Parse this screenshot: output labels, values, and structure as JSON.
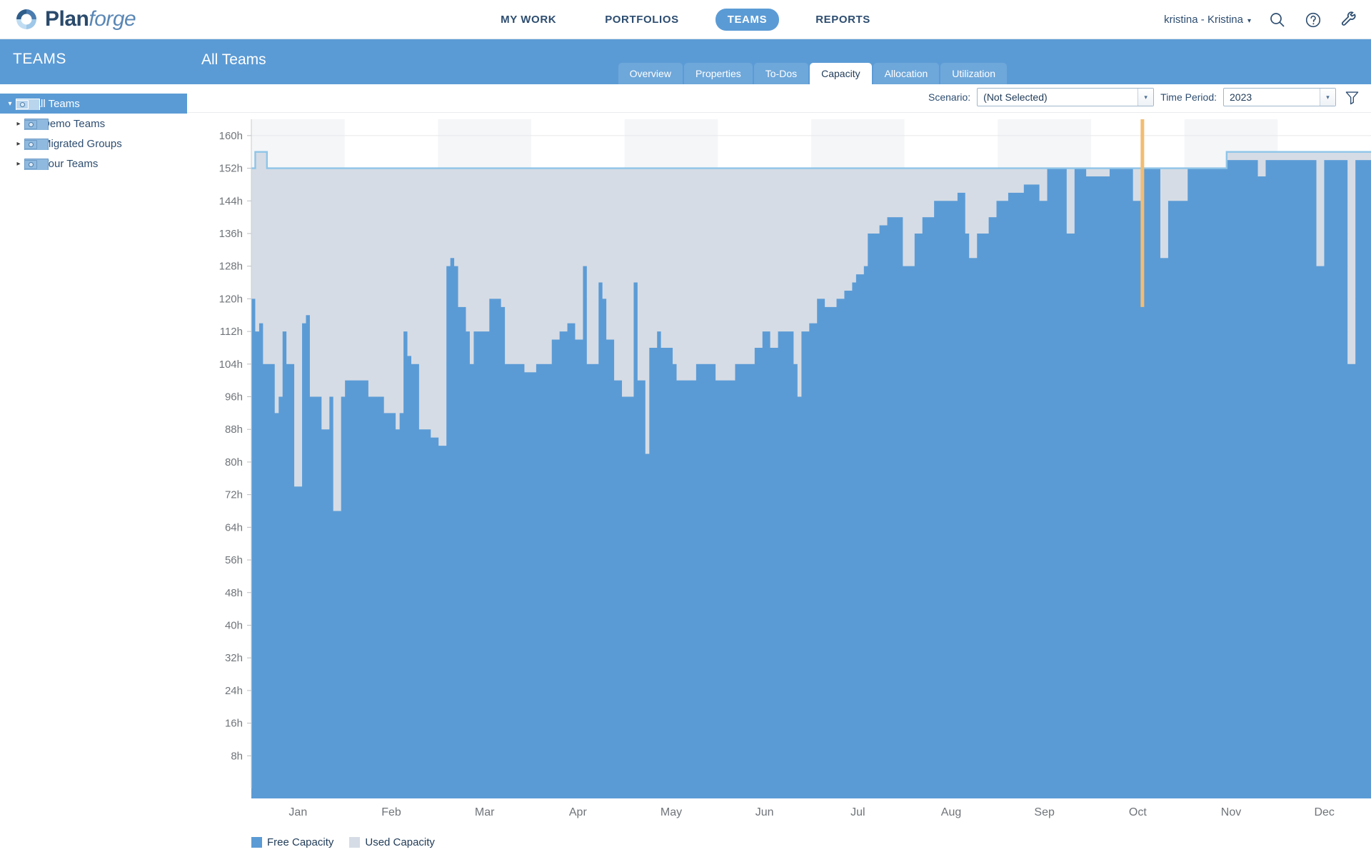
{
  "app": {
    "brand_main": "Plan",
    "brand_italic": "forge",
    "logo_icon": "planforge-swirl-logo"
  },
  "header": {
    "nav": [
      {
        "label": "MY WORK",
        "active": false
      },
      {
        "label": "PORTFOLIOS",
        "active": false
      },
      {
        "label": "TEAMS",
        "active": true
      },
      {
        "label": "REPORTS",
        "active": false
      }
    ],
    "user": "kristina - Kristina",
    "user_caret": "▾",
    "icons": [
      "search-icon",
      "help-icon",
      "tools-wrench-icon"
    ]
  },
  "sidebar": {
    "title": "TEAMS",
    "items": [
      {
        "label": "All Teams",
        "depth": 0,
        "selected": true,
        "twisty": "▾"
      },
      {
        "label": "Demo Teams",
        "depth": 1,
        "selected": false,
        "twisty": "▸"
      },
      {
        "label": "Migrated Groups",
        "depth": 1,
        "selected": false,
        "twisty": "▸"
      },
      {
        "label": "Your Teams",
        "depth": 1,
        "selected": false,
        "twisty": "▸"
      }
    ]
  },
  "page": {
    "title": "All Teams",
    "tabs": [
      {
        "label": "Overview",
        "active": false
      },
      {
        "label": "Properties",
        "active": false
      },
      {
        "label": "To-Dos",
        "active": false
      },
      {
        "label": "Capacity",
        "active": true
      },
      {
        "label": "Allocation",
        "active": false
      },
      {
        "label": "Utilization",
        "active": false
      }
    ]
  },
  "toolbar": {
    "scenario_label": "Scenario:",
    "scenario_value": "(Not Selected)",
    "period_label": "Time Period:",
    "period_value": "2023",
    "dropdown_arrow": "▾",
    "filter_icon": "funnel-filter-icon"
  },
  "colors": {
    "free_capacity": "#5b9bd5",
    "used_capacity": "#d6dce5",
    "capacity_outline": "#8ec4e8",
    "today_marker": "#f2bd72",
    "header_blue": "#5b9bd5",
    "text_dark": "#1f3a57",
    "band_shade": "#f4f6f8",
    "gridline": "#e6e8ea"
  },
  "chart_data": {
    "type": "area",
    "title": "",
    "xlabel": "",
    "ylabel": "",
    "ylim": [
      0,
      164
    ],
    "ytick_step": 8,
    "ytick_unit": "h",
    "yticks": [
      8,
      16,
      24,
      32,
      40,
      48,
      56,
      64,
      72,
      80,
      88,
      96,
      104,
      112,
      120,
      128,
      136,
      144,
      152,
      160
    ],
    "ytick_labels": [
      "8h",
      "16h",
      "24h",
      "32h",
      "40h",
      "48h",
      "56h",
      "64h",
      "72h",
      "80h",
      "88h",
      "96h",
      "104h",
      "112h",
      "120h",
      "128h",
      "136h",
      "144h",
      "152h",
      "160h"
    ],
    "categories": [
      "Jan",
      "Feb",
      "Mar",
      "Apr",
      "May",
      "Jun",
      "Jul",
      "Aug",
      "Sep",
      "Oct",
      "Nov",
      "Dec"
    ],
    "grid": true,
    "legend_position": "bottom-left",
    "today_marker_month_fraction": 9.55,
    "series": [
      {
        "name": "Free Capacity",
        "color": "#5b9bd5",
        "stack": "bottom",
        "values": [
          120,
          112,
          114,
          104,
          104,
          104,
          92,
          96,
          112,
          104,
          104,
          74,
          74,
          114,
          116,
          96,
          96,
          96,
          88,
          88,
          96,
          68,
          68,
          96,
          100,
          100,
          100,
          100,
          100,
          100,
          96,
          96,
          96,
          96,
          92,
          92,
          92,
          88,
          92,
          112,
          106,
          104,
          104,
          88,
          88,
          88,
          86,
          86,
          84,
          84,
          128,
          130,
          128,
          118,
          118,
          112,
          104,
          112,
          112,
          112,
          112,
          120,
          120,
          120,
          118,
          104,
          104,
          104,
          104,
          104,
          102,
          102,
          102,
          104,
          104,
          104,
          104,
          110,
          110,
          112,
          112,
          114,
          114,
          110,
          110,
          128,
          104,
          104,
          104,
          124,
          120,
          110,
          110,
          100,
          100,
          96,
          96,
          96,
          124,
          100,
          100,
          82,
          108,
          108,
          112,
          108,
          108,
          108,
          104,
          100,
          100,
          100,
          100,
          100,
          104,
          104,
          104,
          104,
          104,
          100,
          100,
          100,
          100,
          100,
          104,
          104,
          104,
          104,
          104,
          108,
          108,
          112,
          112,
          108,
          108,
          112,
          112,
          112,
          112,
          104,
          96,
          112,
          112,
          114,
          114,
          120,
          120,
          118,
          118,
          118,
          120,
          120,
          122,
          122,
          124,
          126,
          126,
          128,
          136,
          136,
          136,
          138,
          138,
          140,
          140,
          140,
          140,
          128,
          128,
          128,
          136,
          136,
          140,
          140,
          140,
          144,
          144,
          144,
          144,
          144,
          144,
          146,
          146,
          136,
          130,
          130,
          136,
          136,
          136,
          140,
          140,
          144,
          144,
          144,
          146,
          146,
          146,
          146,
          148,
          148,
          148,
          148,
          144,
          144,
          152,
          152,
          152,
          152,
          152,
          136,
          136,
          152,
          152,
          152,
          150,
          150,
          150,
          150,
          150,
          150,
          152,
          152,
          152,
          152,
          152,
          152,
          144,
          144,
          152,
          152,
          152,
          152,
          152,
          130,
          130,
          144,
          144,
          144,
          144,
          144,
          152,
          152,
          152,
          152,
          152,
          152,
          152,
          152,
          152,
          152,
          154,
          154,
          154,
          154,
          154,
          154,
          154,
          154,
          150,
          150,
          154,
          154,
          154,
          154,
          154,
          154,
          154,
          154,
          154,
          154,
          154,
          154,
          154,
          128,
          128,
          154,
          154,
          154,
          154,
          154,
          154,
          104,
          104,
          154,
          154,
          154,
          154
        ]
      },
      {
        "name": "Used Capacity",
        "color": "#d6dce5",
        "stack": "top",
        "values": [
          32,
          44,
          42,
          52,
          48,
          48,
          60,
          56,
          40,
          48,
          48,
          78,
          78,
          38,
          36,
          56,
          56,
          56,
          64,
          64,
          56,
          84,
          84,
          56,
          52,
          52,
          52,
          52,
          52,
          52,
          56,
          56,
          56,
          56,
          60,
          60,
          60,
          64,
          60,
          40,
          46,
          48,
          48,
          64,
          64,
          64,
          66,
          66,
          68,
          68,
          24,
          22,
          24,
          34,
          34,
          40,
          48,
          40,
          40,
          40,
          40,
          32,
          32,
          32,
          34,
          48,
          48,
          48,
          48,
          48,
          50,
          50,
          50,
          48,
          48,
          48,
          48,
          42,
          42,
          40,
          40,
          38,
          38,
          42,
          42,
          24,
          48,
          48,
          48,
          28,
          32,
          42,
          42,
          52,
          52,
          56,
          56,
          56,
          28,
          52,
          52,
          70,
          44,
          44,
          40,
          44,
          44,
          44,
          48,
          52,
          52,
          52,
          52,
          52,
          48,
          48,
          48,
          48,
          48,
          52,
          52,
          52,
          52,
          52,
          48,
          48,
          48,
          48,
          48,
          44,
          44,
          40,
          40,
          44,
          44,
          40,
          40,
          40,
          40,
          48,
          56,
          40,
          40,
          38,
          38,
          32,
          32,
          34,
          34,
          34,
          32,
          32,
          30,
          30,
          28,
          26,
          26,
          24,
          16,
          16,
          16,
          14,
          14,
          12,
          12,
          12,
          12,
          24,
          24,
          24,
          16,
          16,
          12,
          12,
          12,
          8,
          8,
          8,
          8,
          8,
          8,
          6,
          6,
          16,
          22,
          22,
          16,
          16,
          16,
          12,
          12,
          8,
          8,
          8,
          6,
          6,
          6,
          6,
          4,
          4,
          4,
          4,
          8,
          8,
          0,
          0,
          0,
          0,
          0,
          16,
          16,
          0,
          0,
          0,
          2,
          2,
          2,
          2,
          2,
          2,
          0,
          0,
          0,
          0,
          0,
          0,
          8,
          8,
          0,
          0,
          0,
          0,
          0,
          22,
          22,
          8,
          8,
          8,
          8,
          8,
          0,
          0,
          0,
          0,
          0,
          0,
          0,
          0,
          0,
          0,
          2,
          2,
          2,
          2,
          2,
          2,
          2,
          2,
          6,
          6,
          2,
          2,
          2,
          2,
          2,
          2,
          2,
          2,
          2,
          2,
          2,
          2,
          2,
          28,
          28,
          2,
          2,
          2,
          2,
          2,
          2,
          52,
          52,
          2,
          2,
          2,
          2
        ]
      }
    ],
    "gaps": [
      {
        "start": 0,
        "end": 1,
        "level": 0
      },
      {
        "start": 21,
        "end": 23,
        "level": 0
      }
    ],
    "legend": [
      {
        "label": "Free Capacity",
        "color": "#5b9bd5"
      },
      {
        "label": "Used Capacity",
        "color": "#d6dce5"
      }
    ]
  }
}
